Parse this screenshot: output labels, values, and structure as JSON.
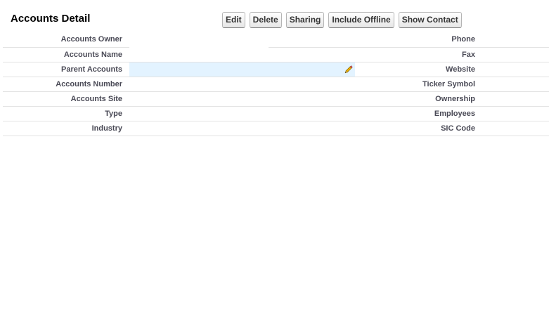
{
  "detail": {
    "title": "Accounts Detail"
  },
  "toolbar": {
    "edit": "Edit",
    "delete": "Delete",
    "sharing": "Sharing",
    "include_offline": "Include Offline",
    "show_contact": "Show Contact"
  },
  "fields": {
    "left": [
      "Accounts Owner",
      "Accounts Name",
      "Parent Accounts",
      "Accounts Number",
      "Accounts Site",
      "Type",
      "Industry"
    ],
    "right": [
      "Phone",
      "Fax",
      "Website",
      "Ticker Symbol",
      "Ownership",
      "Employees",
      "SIC Code"
    ]
  },
  "icons": {
    "inline_edit": "pencil-icon"
  }
}
